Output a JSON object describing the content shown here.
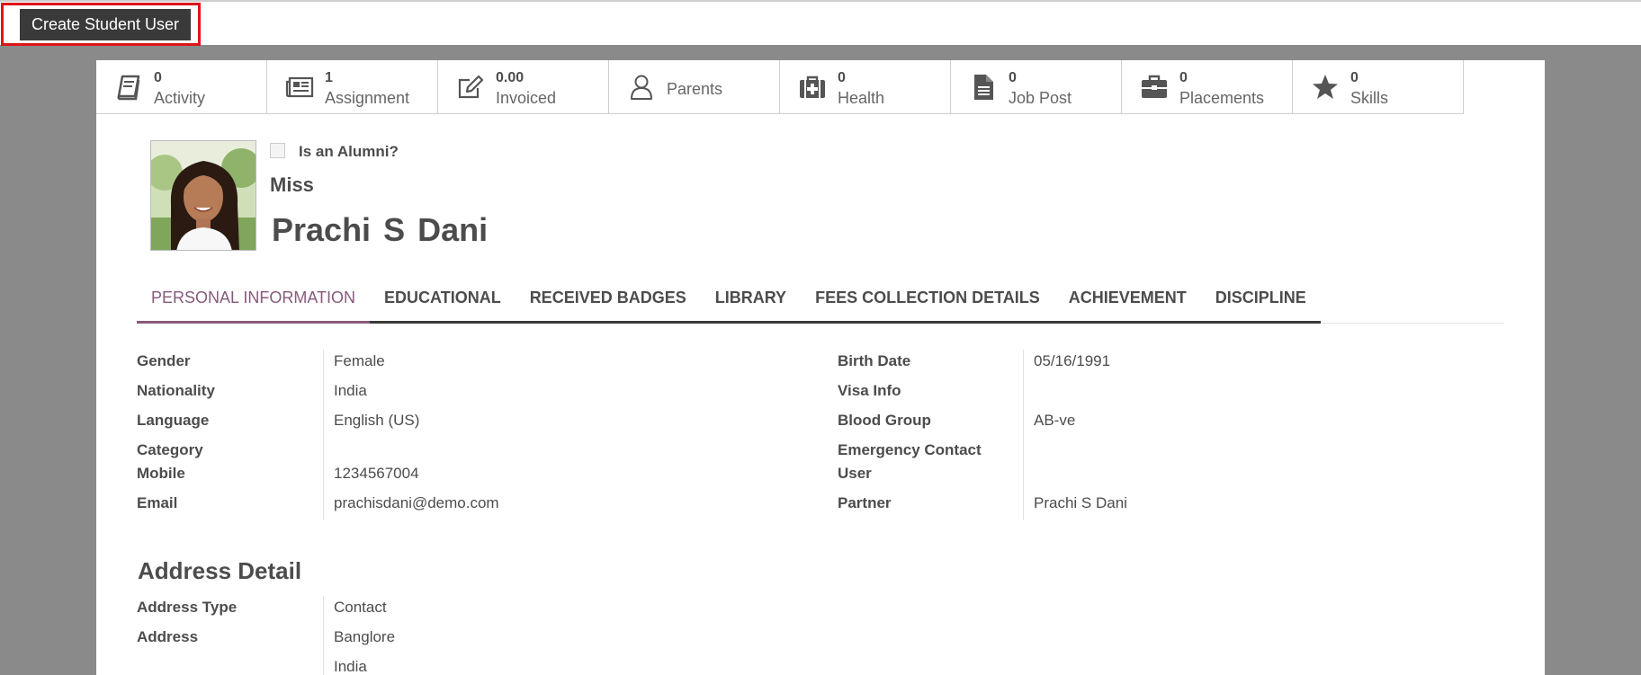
{
  "toolbar": {
    "create_label": "Create Student User"
  },
  "stats": [
    {
      "num": "0",
      "label": "Activity",
      "icon": "book-icon"
    },
    {
      "num": "1",
      "label": "Assignment",
      "icon": "newspaper-icon"
    },
    {
      "num": "0.00",
      "label": "Invoiced",
      "icon": "edit-icon"
    },
    {
      "num": "",
      "label": "Parents",
      "icon": "user-icon"
    },
    {
      "num": "0",
      "label": "Health",
      "icon": "medkit-icon"
    },
    {
      "num": "0",
      "label": "Job Post",
      "icon": "file-icon"
    },
    {
      "num": "0",
      "label": "Placements",
      "icon": "briefcase-icon"
    },
    {
      "num": "0",
      "label": "Skills",
      "icon": "star-icon"
    }
  ],
  "header": {
    "alumni_label": "Is an Alumni?",
    "alumni_checked": false,
    "title": "Miss",
    "first_name": "Prachi",
    "middle_name": "S",
    "last_name": "Dani"
  },
  "tabs": [
    "PERSONAL INFORMATION",
    "EDUCATIONAL",
    "RECEIVED BADGES",
    "LIBRARY",
    "FEES COLLECTION DETAILS",
    "ACHIEVEMENT",
    "DISCIPLINE"
  ],
  "personal": {
    "gender_label": "Gender",
    "gender": "Female",
    "nationality_label": "Nationality",
    "nationality": "India",
    "language_label": "Language",
    "language": "English (US)",
    "category_label": "Category",
    "category": "",
    "mobile_label": "Mobile",
    "mobile": "1234567004",
    "email_label": "Email",
    "email": "prachisdani@demo.com",
    "birth_label": "Birth Date",
    "birth": "05/16/1991",
    "visa_label": "Visa Info",
    "visa": "",
    "blood_label": "Blood Group",
    "blood": "AB-ve",
    "emergency_label_1": "Emergency Contact",
    "emergency_label_2": "User",
    "partner_label": "Partner",
    "partner": "Prachi S Dani"
  },
  "address": {
    "section_title": "Address Detail",
    "type_label": "Address Type",
    "type": "Contact",
    "address_label": "Address",
    "line1": "Banglore",
    "line2": "India"
  },
  "colors": {
    "accent": "#875a7b",
    "highlight": "#e0131a",
    "button": "#3a3a3a",
    "backdrop": "#8a8a8a"
  }
}
